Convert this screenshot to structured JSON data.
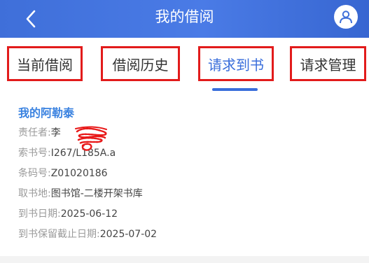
{
  "header": {
    "title": "我的借阅",
    "back_icon": "chevron-left-icon",
    "avatar_icon": "user-icon",
    "color": "#4a7be6"
  },
  "tabs": [
    {
      "label": "当前借阅",
      "active": false
    },
    {
      "label": "借阅历史",
      "active": false
    },
    {
      "label": "请求到书",
      "active": true
    },
    {
      "label": "请求管理",
      "active": false
    }
  ],
  "book": {
    "title": "我的阿勒泰",
    "fields": [
      {
        "label": "责任者:",
        "value": "李"
      },
      {
        "label": "索书号:",
        "value": "I267/L185A.a"
      },
      {
        "label": "条码号:",
        "value": "Z01020186"
      },
      {
        "label": "取书地:",
        "value": "图书馆-二楼开架书库"
      },
      {
        "label": "到书日期:",
        "value": "2025-06-12"
      },
      {
        "label": "到书保留截止日期:",
        "value": "2025-07-02"
      }
    ]
  },
  "colors": {
    "accent": "#3a6edb",
    "highlight_box": "#e21b1b",
    "book_title": "#3a82e0"
  }
}
